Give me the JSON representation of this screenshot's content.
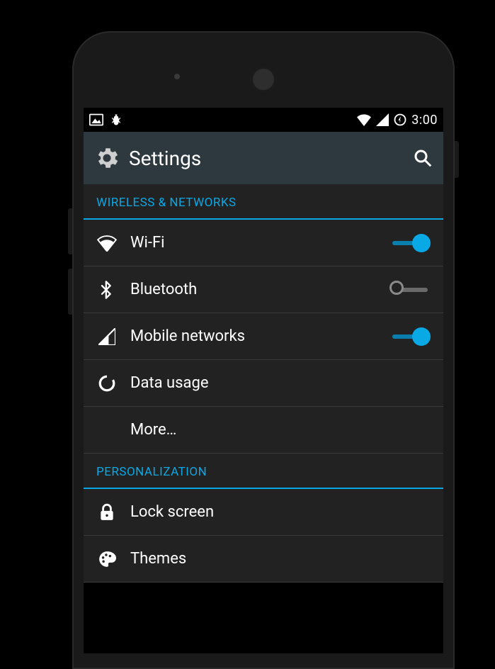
{
  "status": {
    "time": "3:00"
  },
  "app_bar": {
    "title": "Settings"
  },
  "sections": {
    "wireless": {
      "header": "WIRELESS & NETWORKS",
      "wifi": {
        "label": "Wi-Fi",
        "on": true
      },
      "bluetooth": {
        "label": "Bluetooth",
        "on": false
      },
      "mobile": {
        "label": "Mobile networks",
        "on": true
      },
      "data_usage": {
        "label": "Data usage"
      },
      "more": {
        "label": "More…"
      }
    },
    "personalization": {
      "header": "PERSONALIZATION",
      "lock_screen": {
        "label": "Lock screen"
      },
      "themes": {
        "label": "Themes"
      }
    }
  },
  "colors": {
    "accent": "#09a9e6",
    "app_bar_bg": "#2d383f",
    "content_bg": "#222222"
  }
}
